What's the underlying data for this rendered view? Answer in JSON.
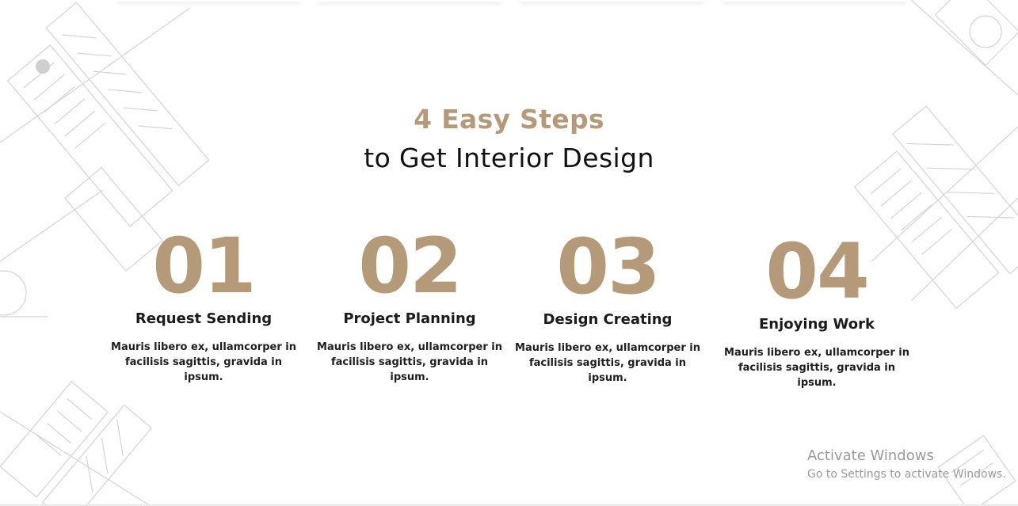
{
  "section": {
    "heading_accent": "4 Easy Steps",
    "heading_main": "to Get Interior Design"
  },
  "steps": [
    {
      "number": "01",
      "title": "Request Sending",
      "description": "Mauris libero ex, ullamcorper in facilisis sagittis, gravida in ipsum."
    },
    {
      "number": "02",
      "title": "Project Planning",
      "description": "Mauris libero ex, ullamcorper in facilisis sagittis, gravida in ipsum."
    },
    {
      "number": "03",
      "title": "Design Creating",
      "description": "Mauris libero ex, ullamcorper in facilisis sagittis, gravida in ipsum."
    },
    {
      "number": "04",
      "title": "Enjoying Work",
      "description": "Mauris libero ex, ullamcorper in facilisis sagittis, gravida in ipsum."
    }
  ],
  "watermark": {
    "line1": "Activate Windows",
    "line2": "Go to Settings to activate Windows."
  },
  "colors": {
    "accent": "#b49a79",
    "text": "#1b1b1b",
    "background": "#ffffff"
  }
}
